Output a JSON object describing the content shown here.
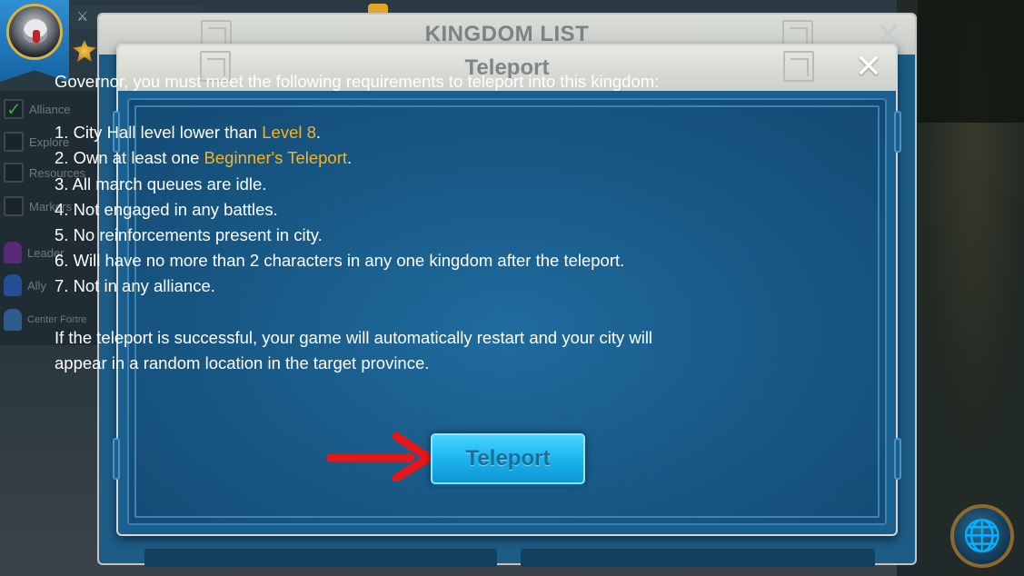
{
  "kingdom_list": {
    "title": "KINGDOM LIST",
    "close_label": "✕"
  },
  "side_panel": {
    "items": [
      {
        "label": "Alliance",
        "checked": true
      },
      {
        "label": "Explore",
        "checked": false
      },
      {
        "label": "Resources",
        "checked": false
      },
      {
        "label": "Markers",
        "checked": false
      },
      {
        "label": "Leader",
        "figure_color": "#6b2c8e"
      },
      {
        "label": "Ally",
        "figure_color": "#2a5fb0"
      },
      {
        "label": "Center Fortre",
        "figure_color": "#3a6ea8"
      }
    ]
  },
  "teleport_dialog": {
    "title": "Teleport",
    "close_label": "✕",
    "intro": "Governor, you must meet the following requirements to teleport into this kingdom:",
    "requirements": [
      {
        "prefix": "1. City Hall level lower than ",
        "highlight": "Level 8",
        "suffix": "."
      },
      {
        "prefix": "2. Own at least one ",
        "highlight": "Beginner's Teleport",
        "suffix": "."
      },
      {
        "prefix": "3. All march queues are idle.",
        "highlight": "",
        "suffix": ""
      },
      {
        "prefix": "4. Not engaged in any battles.",
        "highlight": "",
        "suffix": ""
      },
      {
        "prefix": "5. No reinforcements present in city.",
        "highlight": "",
        "suffix": ""
      },
      {
        "prefix": "6. Will have no more than 2 characters in any one kingdom after the teleport.",
        "highlight": "",
        "suffix": ""
      },
      {
        "prefix": "7. Not in any alliance.",
        "highlight": "",
        "suffix": ""
      }
    ],
    "footer_line1": "If the teleport is successful, your game will automatically restart and your city will",
    "footer_line2": "appear in a random location in the target province.",
    "button_label": "Teleport"
  },
  "colors": {
    "highlight": "#f2b42a",
    "arrow": "#e81717",
    "button": "#1ab2ec"
  },
  "icons": {
    "close": "close-icon",
    "globe": "globe-icon",
    "sword": "sword-icon",
    "arrow": "red-arrow-annotation"
  }
}
